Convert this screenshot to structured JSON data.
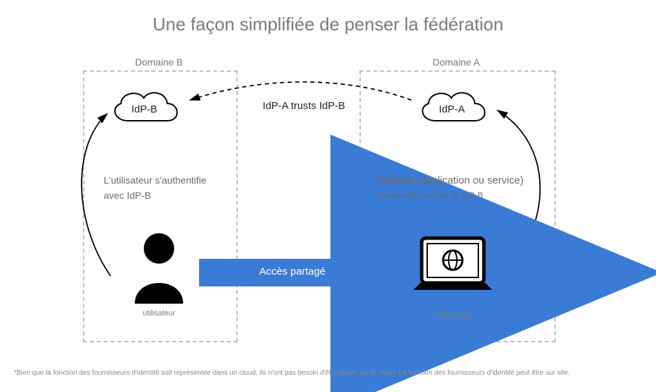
{
  "title": "Une façon simplifiée de penser la fédération",
  "domainB": {
    "label": "Domaine B"
  },
  "domainA": {
    "label": "Domaine A"
  },
  "idpB": {
    "label": "IdP-B"
  },
  "idpA": {
    "label": "IdP-A"
  },
  "trust": "IdP-A trusts IdP-B",
  "authB": {
    "line1": "L'utilisateur s'authentifie",
    "line2": "avec IdP-B"
  },
  "authA": {
    "line1": "Website (application ou service)",
    "line2": "s'authentifie auprès de IdP-B"
  },
  "shared": "Accès partagé",
  "userCaption": "utilisateur",
  "siteCaption": "Site web",
  "footnote": "*Bien que la fonction des fournisseurs d'identité soit représentée dans un cloud, ils n'ont pas besoin d'être basés sur le cloud. La fonction des fournisseurs d'identité peut être sur site.",
  "colors": {
    "arrow": "#3a7bd5"
  }
}
